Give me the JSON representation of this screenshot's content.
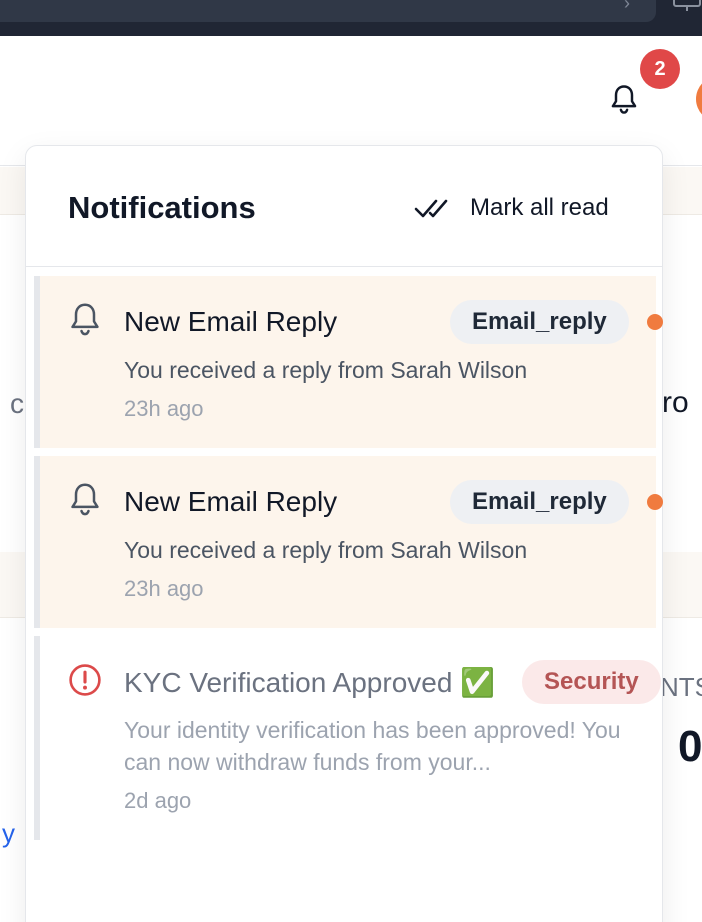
{
  "header": {
    "bell_icon": "bell-icon",
    "notification_count": "2"
  },
  "background": {
    "left_fragment": "c",
    "right_fragment": "ro",
    "right_label_fragment": "NTS",
    "right_value_fragment": "0",
    "left_link_fragment": "y"
  },
  "popover": {
    "title": "Notifications",
    "mark_all_label": "Mark all read",
    "mark_all_icon": "double-check-icon",
    "notifications": [
      {
        "title": "New Email Reply",
        "tag": "Email_reply",
        "message": "You received a reply from Sarah Wilson",
        "time": "23h ago",
        "icon": "bell-icon",
        "unread": true
      },
      {
        "title": "New Email Reply",
        "tag": "Email_reply",
        "message": "You received a reply from Sarah Wilson",
        "time": "23h ago",
        "icon": "bell-icon",
        "unread": true
      },
      {
        "title": "KYC Verification Approved ✅",
        "tag": "Security",
        "message": "Your identity verification has been approved! You can now withdraw funds from your...",
        "time": "2d ago",
        "icon": "alert-circle-icon",
        "unread": false
      }
    ]
  },
  "colors": {
    "badge": "#e04848",
    "unread_bg": "#fdf5ec",
    "unread_dot": "#f07b3f",
    "security_tag_text": "#b45555",
    "security_tag_bg": "#fbe9e9"
  }
}
